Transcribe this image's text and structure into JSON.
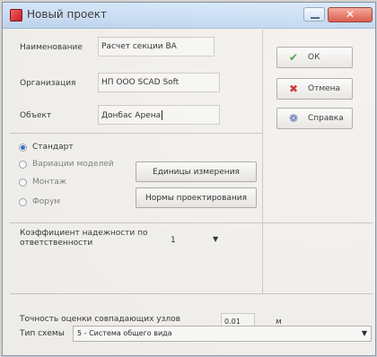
{
  "window": {
    "title": "Новый проект",
    "close_glyph": "✕"
  },
  "form": {
    "name_label": "Наименование",
    "name_value": "Расчет секции ВА",
    "org_label": "Организация",
    "org_value": "НП ООО SCAD Soft",
    "object_label": "Объект",
    "object_value": "Донбас Арена"
  },
  "actions": {
    "ok_label": "ОК",
    "cancel_label": "Отмена",
    "help_label": "Справка"
  },
  "modes": [
    {
      "label": "Стандарт",
      "checked": true,
      "muted": false
    },
    {
      "label": "Вариации моделей",
      "checked": false,
      "muted": true
    },
    {
      "label": "Монтаж",
      "checked": false,
      "muted": true
    },
    {
      "label": "Форум",
      "checked": false,
      "muted": true
    }
  ],
  "settings_buttons": {
    "units_label": "Единицы измерения",
    "norms_label": "Нормы проектирования"
  },
  "reliability": {
    "label": "Коэффициент надежности по ответственности",
    "value": "1"
  },
  "accuracy": {
    "label": "Точность оценки совпадающих узлов",
    "value": "0.01",
    "unit": "м"
  },
  "scheme": {
    "label": "Тип схемы",
    "value": "5 - Система общего вида"
  },
  "icons": {
    "app": "app-icon",
    "ok": "checkmark-icon",
    "cancel": "cross-icon",
    "help": "help-icon",
    "dropdown": "chevron-down-icon"
  }
}
